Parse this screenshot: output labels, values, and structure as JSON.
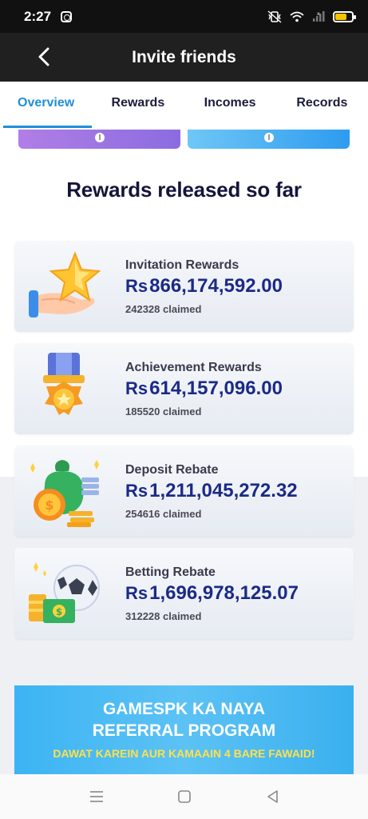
{
  "status_bar": {
    "time": "2:27"
  },
  "header": {
    "title": "Invite friends"
  },
  "tabs": [
    {
      "label": "Overview",
      "active": true
    },
    {
      "label": "Rewards",
      "active": false
    },
    {
      "label": "Incomes",
      "active": false
    },
    {
      "label": "Records",
      "active": false
    }
  ],
  "section_title": "Rewards released so far",
  "rewards": [
    {
      "name": "Invitation Rewards",
      "currency": "Rs",
      "amount": "866,174,592.00",
      "claimed": "242328 claimed",
      "icon": "hand-star-icon"
    },
    {
      "name": "Achievement Rewards",
      "currency": "Rs",
      "amount": "614,157,096.00",
      "claimed": "185520 claimed",
      "icon": "medal-icon"
    },
    {
      "name": "Deposit Rebate",
      "currency": "Rs",
      "amount": "1,211,045,272.32",
      "claimed": "254616 claimed",
      "icon": "money-bag-icon"
    },
    {
      "name": "Betting Rebate",
      "currency": "Rs",
      "amount": "1,696,978,125.07",
      "claimed": "312228 claimed",
      "icon": "football-cash-icon"
    }
  ],
  "banner": {
    "line1": "GAMESPK KA NAYA",
    "line2": "REFERRAL PROGRAM",
    "line3": "DAWAT KAREIN AUR KAMAAIN 4 BARE FAWAID!"
  },
  "colors": {
    "accent": "#1f8fd6",
    "amount": "#1b2a86",
    "header_bg": "#202020",
    "banner_text_highlight": "#ffe14a"
  }
}
